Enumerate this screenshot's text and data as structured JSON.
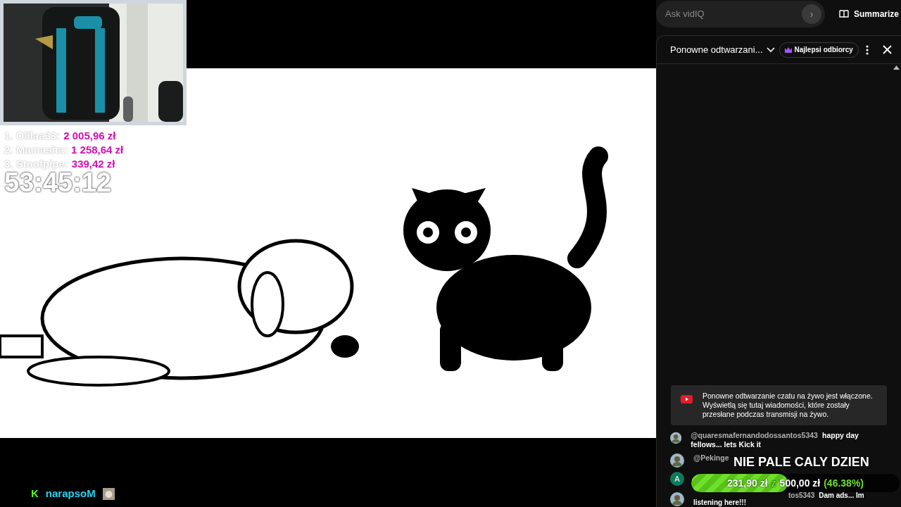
{
  "video": {
    "overlay": {
      "leaderboard": [
        {
          "name": "1. Olllaa33:",
          "amount": "2 005,96 zł"
        },
        {
          "name": "2. Mamasita:",
          "amount": "1 258,64 zł"
        },
        {
          "name": "3. Stoofpipe:",
          "amount": "339,42 zł"
        }
      ],
      "timer": "53:45:12",
      "channel": {
        "badge": "K",
        "name": "narapsoM"
      },
      "goal": {
        "title": "NIE PALE CALY DZIEN",
        "raised": "231,90 zł",
        "separator": "z",
        "target": "500,00 zł",
        "percent": "(46.38%)",
        "level": 0.4638
      }
    }
  },
  "vidiq": {
    "placeholder": "Ask vidIQ",
    "send": "›",
    "summarize": "Summarize"
  },
  "chat": {
    "title": "Ponowne odtwarzani...",
    "filter": "Najlepsi odbiorcy",
    "notice": "Ponowne odtwarzanie czatu na żywo jest włączone. Wyświetlą się tutaj wiadomości, które zostały przesłane podczas transmisji na żywo.",
    "messages": [
      {
        "author": "@quaresmafernandodossantos5343",
        "text": "happy day fellows... lets Kick it"
      },
      {
        "author": "@Pekinge"
      },
      {
        "kind": "letter",
        "initial": "A"
      },
      {
        "author": "tos5343",
        "text": "Dam ads... Im",
        "text2": "listening here!!!"
      }
    ]
  }
}
